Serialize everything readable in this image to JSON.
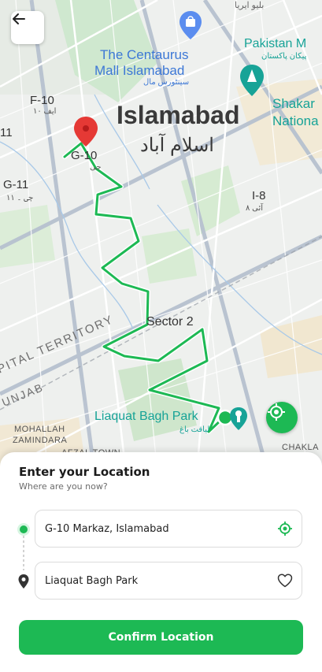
{
  "map": {
    "city_name": "Islamabad",
    "city_name_urdu": "اسلام آباد",
    "labels": {
      "centaurus_line1": "The Centaurus",
      "centaurus_line2": "Mall Islamabad",
      "centaurus_urdu": "سینٹورس مال",
      "pakistan_monument": "Pakistan M",
      "pakistan_monument_urdu": "پیکان پاکستان",
      "shakar_line1": "Shakar",
      "shakar_line2": "Nationa",
      "f10": "F-10",
      "f10_urdu": "ایف ۱۰",
      "g10": "G-10",
      "g10_urdu": "جی",
      "g11": "G-11",
      "g11_urdu": "جی ۔ ۱۱",
      "eleven": "11",
      "i8": "I-8",
      "i8_urdu": "آئی ۸",
      "sector2": "Sector 2",
      "capital_territory": "PITAL TERRITORY",
      "punjab": "UNJAB",
      "liaquat": "Liaquat Bagh Park",
      "liaquat_urdu": "لیاقت باغ",
      "mohalla_line1": "MOHALLAH",
      "mohalla_line2": "ZAMINDARA",
      "afzal": "AFZAL TOWN",
      "chakla": "CHAKLA",
      "top_right_urdu": "بلیو ایریا"
    },
    "route_color": "#1db954",
    "pin_color": "#e53935"
  },
  "sheet": {
    "title": "Enter your Location",
    "subtitle": "Where are you now?",
    "origin": {
      "value": "G-10 Markaz, Islamabad"
    },
    "destination": {
      "value": "Liaquat Bagh Park"
    },
    "confirm_label": "Confirm Location"
  },
  "colors": {
    "accent": "#1db954",
    "text": "#1b1b1b",
    "muted": "#6b6b6b"
  },
  "icons": {
    "back": "arrow-left-icon",
    "map_locate": "crosshair-icon",
    "origin_dot": "origin-dot-icon",
    "destination_pin": "map-pin-icon",
    "field_locate": "crosshair-icon",
    "favorite": "heart-icon"
  }
}
